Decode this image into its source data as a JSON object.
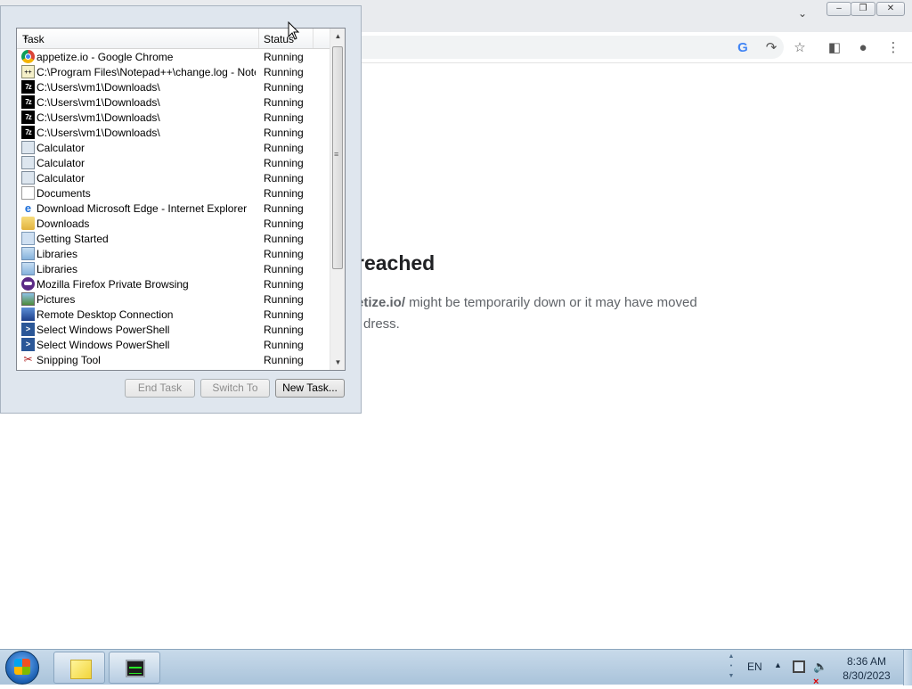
{
  "browser": {
    "error_heading": "reached",
    "error_line1_bold": "etize.io/",
    "error_line1_rest": " might be temporarily down or it may have moved",
    "error_line2": "dress."
  },
  "task_manager": {
    "columns": {
      "task": "Task",
      "status": "Status"
    },
    "tasks": [
      {
        "icon": "chrome-icon",
        "name": "appetize.io - Google Chrome",
        "status": "Running"
      },
      {
        "icon": "notepad-plus-plus-icon",
        "name": "C:\\Program Files\\Notepad++\\change.log - Note...",
        "status": "Running"
      },
      {
        "icon": "7zip-icon",
        "name": "C:\\Users\\vm1\\Downloads\\",
        "status": "Running"
      },
      {
        "icon": "7zip-icon",
        "name": "C:\\Users\\vm1\\Downloads\\",
        "status": "Running"
      },
      {
        "icon": "7zip-icon",
        "name": "C:\\Users\\vm1\\Downloads\\",
        "status": "Running"
      },
      {
        "icon": "7zip-icon",
        "name": "C:\\Users\\vm1\\Downloads\\",
        "status": "Running"
      },
      {
        "icon": "calculator-icon",
        "name": "Calculator",
        "status": "Running"
      },
      {
        "icon": "calculator-icon",
        "name": "Calculator",
        "status": "Running"
      },
      {
        "icon": "calculator-icon",
        "name": "Calculator",
        "status": "Running"
      },
      {
        "icon": "documents-icon",
        "name": "Documents",
        "status": "Running"
      },
      {
        "icon": "internet-explorer-icon",
        "name": "Download Microsoft Edge - Internet Explorer",
        "status": "Running"
      },
      {
        "icon": "folder-icon",
        "name": "Downloads",
        "status": "Running"
      },
      {
        "icon": "getting-started-icon",
        "name": "Getting Started",
        "status": "Running"
      },
      {
        "icon": "libraries-icon",
        "name": "Libraries",
        "status": "Running"
      },
      {
        "icon": "libraries-icon",
        "name": "Libraries",
        "status": "Running"
      },
      {
        "icon": "firefox-private-icon",
        "name": "Mozilla Firefox Private Browsing",
        "status": "Running"
      },
      {
        "icon": "pictures-icon",
        "name": "Pictures",
        "status": "Running"
      },
      {
        "icon": "remote-desktop-icon",
        "name": "Remote Desktop Connection",
        "status": "Running"
      },
      {
        "icon": "powershell-icon",
        "name": "Select Windows PowerShell",
        "status": "Running"
      },
      {
        "icon": "powershell-icon",
        "name": "Select Windows PowerShell",
        "status": "Running"
      },
      {
        "icon": "snipping-tool-icon",
        "name": "Snipping Tool",
        "status": "Running"
      }
    ],
    "buttons": {
      "end_task": "End Task",
      "switch_to": "Switch To",
      "new_task": "New Task..."
    }
  },
  "taskbar": {
    "language": "EN",
    "time": "8:36 AM",
    "date": "8/30/2023"
  }
}
